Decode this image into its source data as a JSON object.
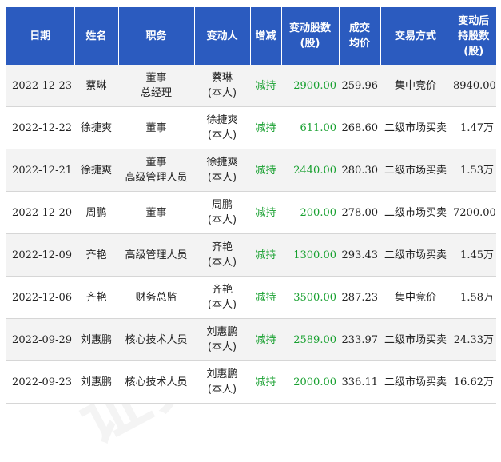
{
  "headers": [
    [
      "日期"
    ],
    [
      "姓名"
    ],
    [
      "职务"
    ],
    [
      "变动人"
    ],
    [
      "增减"
    ],
    [
      "变动股数",
      "(股)"
    ],
    [
      "成交",
      "均价"
    ],
    [
      "交易方式"
    ],
    [
      "变动后",
      "持股数",
      "(股)"
    ]
  ],
  "rows": [
    {
      "date": "2022-12-23",
      "name": "蔡琳",
      "position": [
        "董事",
        "总经理"
      ],
      "changer": [
        "蔡琳",
        "(本人)"
      ],
      "change": "减持",
      "shares": "2900.00",
      "price": "259.96",
      "method": "集中竞价",
      "after": "8940.00"
    },
    {
      "date": "2022-12-22",
      "name": "徐捷爽",
      "position": [
        "董事"
      ],
      "changer": [
        "徐捷爽",
        "(本人)"
      ],
      "change": "减持",
      "shares": "611.00",
      "price": "268.60",
      "method": "二级市场买卖",
      "after": "1.47万"
    },
    {
      "date": "2022-12-21",
      "name": "徐捷爽",
      "position": [
        "董事",
        "高级管理人员"
      ],
      "changer": [
        "徐捷爽",
        "(本人)"
      ],
      "change": "减持",
      "shares": "2440.00",
      "price": "280.30",
      "method": "二级市场买卖",
      "after": "1.53万"
    },
    {
      "date": "2022-12-20",
      "name": "周鹏",
      "position": [
        "董事"
      ],
      "changer": [
        "周鹏",
        "(本人)"
      ],
      "change": "减持",
      "shares": "200.00",
      "price": "278.00",
      "method": "二级市场买卖",
      "after": "7200.00"
    },
    {
      "date": "2022-12-09",
      "name": "齐艳",
      "position": [
        "高级管理人员"
      ],
      "changer": [
        "齐艳",
        "(本人)"
      ],
      "change": "减持",
      "shares": "1300.00",
      "price": "293.43",
      "method": "二级市场买卖",
      "after": "1.45万"
    },
    {
      "date": "2022-12-06",
      "name": "齐艳",
      "position": [
        "财务总监"
      ],
      "changer": [
        "齐艳",
        "(本人)"
      ],
      "change": "减持",
      "shares": "3500.00",
      "price": "287.23",
      "method": "集中竞价",
      "after": "1.58万"
    },
    {
      "date": "2022-09-29",
      "name": "刘惠鹏",
      "position": [
        "核心技术人员"
      ],
      "changer": [
        "刘惠鹏",
        "(本人)"
      ],
      "change": "减持",
      "shares": "2589.00",
      "price": "233.97",
      "method": "二级市场买卖",
      "after": "24.33万"
    },
    {
      "date": "2022-09-23",
      "name": "刘惠鹏",
      "position": [
        "核心技术人员"
      ],
      "changer": [
        "刘惠鹏",
        "(本人)"
      ],
      "change": "减持",
      "shares": "2000.00",
      "price": "336.11",
      "method": "二级市场买卖",
      "after": "16.62万"
    }
  ],
  "watermark": "证券之星",
  "colors": {
    "header_bg": "#2b5bbf",
    "header_text": "#ffffff",
    "reduce": "#17a02f",
    "odd_row": "#f3f3f3"
  }
}
